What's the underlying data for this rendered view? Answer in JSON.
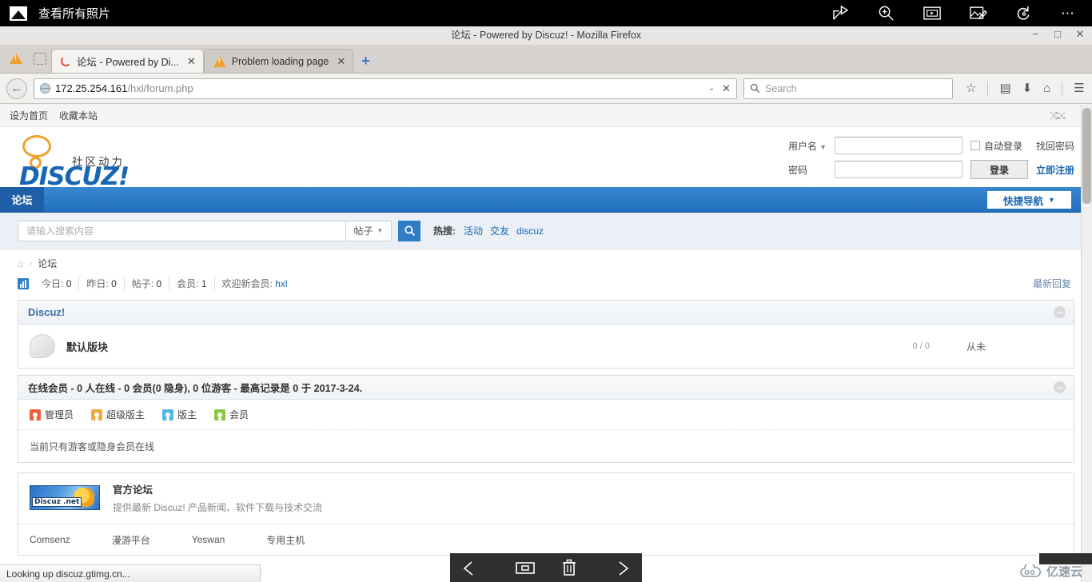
{
  "photo_viewer": {
    "app_title": "查看所有照片",
    "app_icon": "photo-icon",
    "tools": [
      {
        "name": "share-icon",
        "glyph": "↱"
      },
      {
        "name": "zoom-in-icon",
        "glyph": "⊕"
      },
      {
        "name": "slideshow-icon",
        "glyph": "▣"
      },
      {
        "name": "edit-image-icon",
        "glyph": "✎"
      },
      {
        "name": "rotate-icon",
        "glyph": "↺"
      },
      {
        "name": "more-options-icon",
        "glyph": "⋯"
      }
    ],
    "bottom_controls": [
      {
        "name": "previous-photo-button",
        "glyph": "←"
      },
      {
        "name": "filmstrip-button",
        "glyph": "▭"
      },
      {
        "name": "delete-photo-button",
        "glyph": "🗑"
      },
      {
        "name": "next-photo-button",
        "glyph": "→"
      }
    ]
  },
  "browser": {
    "window_title": "论坛 - Powered by Discuz! - Mozilla Firefox",
    "window_buttons": [
      "−",
      "□",
      "✕"
    ],
    "tabs": [
      {
        "label": "论坛 - Powered by Di...",
        "close": "✕",
        "state": "active",
        "icon": "loading-spinner-icon"
      },
      {
        "label": "Problem loading page",
        "close": "✕",
        "state": "inactive",
        "icon": "warning-icon"
      }
    ],
    "new_tab_label": "+",
    "back_button": "←",
    "url_domain": "172.25.254.161",
    "url_path": "/hxl/forum.php",
    "url_dropdown": "⌄",
    "url_stop": "✕",
    "search_placeholder": "Search",
    "search_value": "",
    "nav_icons": [
      {
        "name": "bookmark-star-icon",
        "glyph": "☆"
      },
      {
        "name": "reading-list-icon",
        "glyph": "▤"
      },
      {
        "name": "downloads-icon",
        "glyph": "⬇"
      },
      {
        "name": "home-icon",
        "glyph": "⌂"
      },
      {
        "name": "menu-icon",
        "glyph": "☰"
      }
    ],
    "status_text": "Looking up discuz.gtimg.cn..."
  },
  "site": {
    "topbar": {
      "set_homepage": "设为首页",
      "bookmark_site": "收藏本站",
      "shrink_icon": "collapse-icon"
    },
    "logo": {
      "tagline": "社区动力",
      "wordmark": "DISCUZ!",
      "brand_blue": "#1866b3",
      "brand_orange": "#f0a32a"
    },
    "login": {
      "username_label": "用户名",
      "username_value": "",
      "password_label": "密码",
      "password_value": "",
      "autologin_label": "自动登录",
      "autologin_checked": false,
      "submit_label": "登录",
      "find_password_label": "找回密码",
      "register_label": "立即注册"
    },
    "nav": {
      "active_tab": "论坛",
      "quicknav_label": "快捷导航"
    },
    "search": {
      "placeholder": "请输入搜索内容",
      "value": "",
      "type_selected": "帖子",
      "button_icon": "search-icon",
      "hot_label": "热搜:",
      "hot_links": [
        "活动",
        "交友",
        "discuz"
      ]
    },
    "breadcrumb": {
      "home_icon": "home-icon",
      "separator": "›",
      "current": "论坛"
    },
    "stats": {
      "icon": "chart-icon",
      "items": [
        {
          "label": "今日:",
          "value": "0"
        },
        {
          "label": "昨日:",
          "value": "0"
        },
        {
          "label": "帖子:",
          "value": "0"
        },
        {
          "label": "会员:",
          "value": "1"
        }
      ],
      "welcome_label": "欢迎新会员:",
      "welcome_member": "hxl",
      "latest_reply_label": "最新回复"
    },
    "forum_category": {
      "title": "Discuz!",
      "collapse_icon": "−",
      "boards": [
        {
          "name": "默认版块",
          "counts": "0 / 0",
          "last_post": "从未",
          "icon": "forum-icon"
        }
      ]
    },
    "online": {
      "title": "在线会员 - 0 人在线 - 0 会员(0 隐身), 0 位游客 - 最高记录是 0 于 2017-3-24.",
      "collapse_icon": "−",
      "legend": [
        {
          "label": "管理员",
          "color": "#e8603c"
        },
        {
          "label": "超级版主",
          "color": "#f0ab3d"
        },
        {
          "label": "版主",
          "color": "#4fb8e0"
        },
        {
          "label": "会员",
          "color": "#8cc63f"
        }
      ],
      "note": "当前只有游客或隐身会员在线"
    },
    "promo": {
      "badge_text": "Discuz .net",
      "title": "官方论坛",
      "description": "提供最新 Discuz! 产品新闻、软件下载与技术交流"
    },
    "footer_links": [
      "Comsenz",
      "漫游平台",
      "Yeswan",
      "专用主机"
    ]
  },
  "watermark": {
    "text": "亿速云",
    "icon": "cloud-icon",
    "color": "#8e9aa6"
  }
}
